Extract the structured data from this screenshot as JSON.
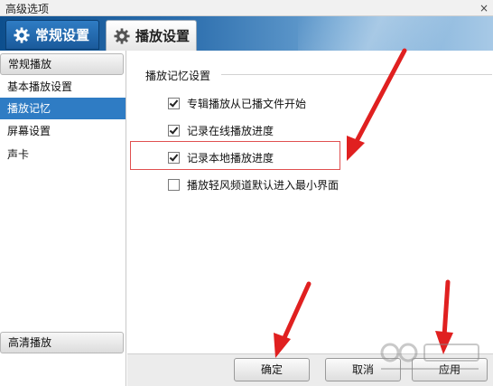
{
  "window": {
    "title": "高级选项",
    "close_glyph": "×"
  },
  "tabs": [
    {
      "label": "常规设置",
      "icon": "gear-icon",
      "active": true
    },
    {
      "label": "播放设置",
      "icon": "gear-icon",
      "active": false
    }
  ],
  "sidebar": {
    "section_top": "常规播放",
    "items": [
      {
        "label": "基本播放设置",
        "selected": false
      },
      {
        "label": "播放记忆",
        "selected": true
      },
      {
        "label": "屏幕设置",
        "selected": false
      },
      {
        "label": "声卡",
        "selected": false
      }
    ],
    "section_bottom": "高清播放"
  },
  "main": {
    "group_title": "播放记忆设置",
    "options": [
      {
        "label": "专辑播放从已播文件开始",
        "checked": true
      },
      {
        "label": "记录在线播放进度",
        "checked": true
      },
      {
        "label": "记录本地播放进度",
        "checked": true
      },
      {
        "label": "播放轻风频道默认进入最小界面",
        "checked": false
      }
    ]
  },
  "footer": {
    "ok_label": "确定",
    "cancel_label": "取消",
    "apply_label": "应用"
  },
  "colors": {
    "accent": "#2f7cc4",
    "annotation_red": "#e02020"
  }
}
